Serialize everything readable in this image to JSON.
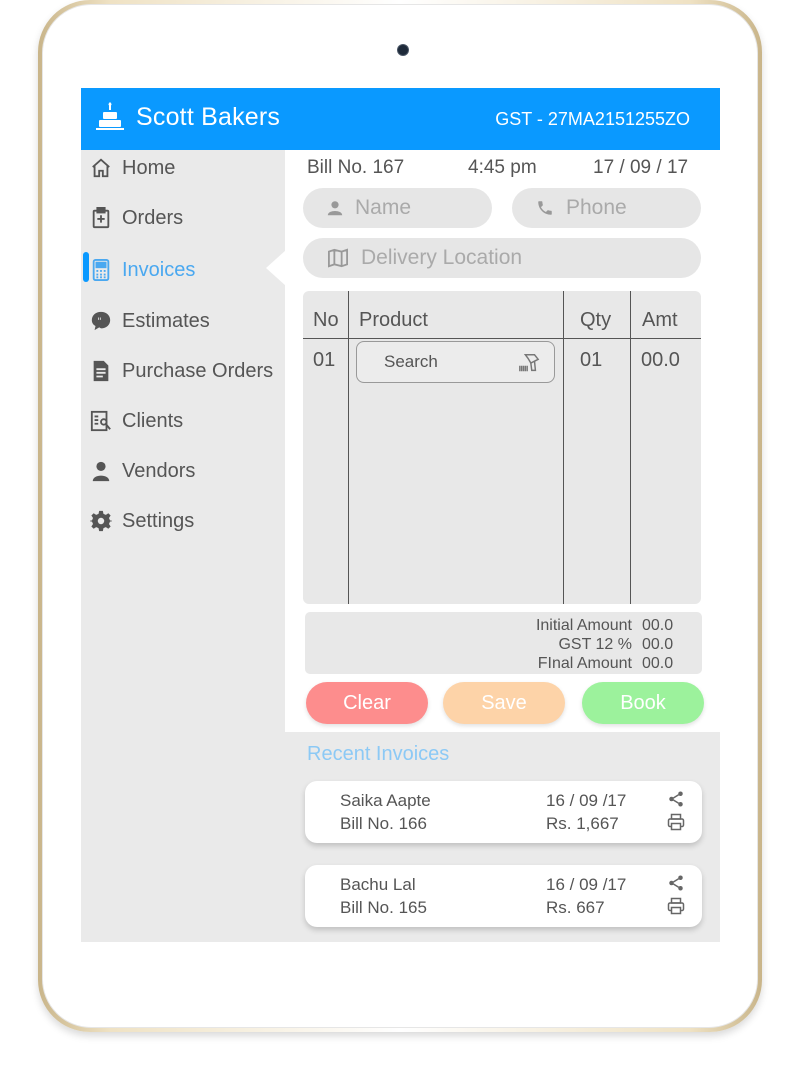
{
  "app": {
    "title": "Scott Bakers",
    "gst": "GST - 27MA2151255ZO",
    "brand_color": "#0a99ff"
  },
  "sidebar": {
    "items": [
      {
        "label": "Home",
        "icon": "home-icon"
      },
      {
        "label": "Orders",
        "icon": "clipboard-plus-icon"
      },
      {
        "label": "Invoices",
        "icon": "calculator-icon",
        "active": true
      },
      {
        "label": "Estimates",
        "icon": "quote-bubble-icon"
      },
      {
        "label": "Purchase Orders",
        "icon": "document-icon"
      },
      {
        "label": "Clients",
        "icon": "contacts-icon"
      },
      {
        "label": "Vendors",
        "icon": "person-icon"
      },
      {
        "label": "Settings",
        "icon": "gear-icon"
      }
    ]
  },
  "bill": {
    "number": "Bill No. 167",
    "time": "4:45 pm",
    "date": "17 / 09 / 17"
  },
  "form": {
    "name_placeholder": "Name",
    "phone_placeholder": "Phone",
    "location_placeholder": "Delivery Location"
  },
  "table": {
    "headers": {
      "no": "No",
      "product": "Product",
      "qty": "Qty",
      "amt": "Amt"
    },
    "row": {
      "no": "01",
      "search_placeholder": "Search",
      "qty": "01",
      "amt": "00.0"
    }
  },
  "totals": {
    "initial_label": "Initial Amount",
    "initial_value": "00.0",
    "gst_label": "GST 12 %",
    "gst_value": "00.0",
    "final_label": "FInal Amount",
    "final_value": "00.0"
  },
  "buttons": {
    "clear": "Clear",
    "save": "Save",
    "book": "Book",
    "clear_color": "#fd8d8d",
    "save_color": "#fdd3a8",
    "book_color": "#9cf29c"
  },
  "recent": {
    "title": "Recent Invoices",
    "invoices": [
      {
        "name": "Saika Aapte",
        "bill": "Bill No. 166",
        "date": "16 / 09 /17",
        "amount": "Rs. 1,667"
      },
      {
        "name": "Bachu Lal",
        "bill": "Bill No. 165",
        "date": "16 / 09 /17",
        "amount": "Rs. 667"
      }
    ]
  }
}
